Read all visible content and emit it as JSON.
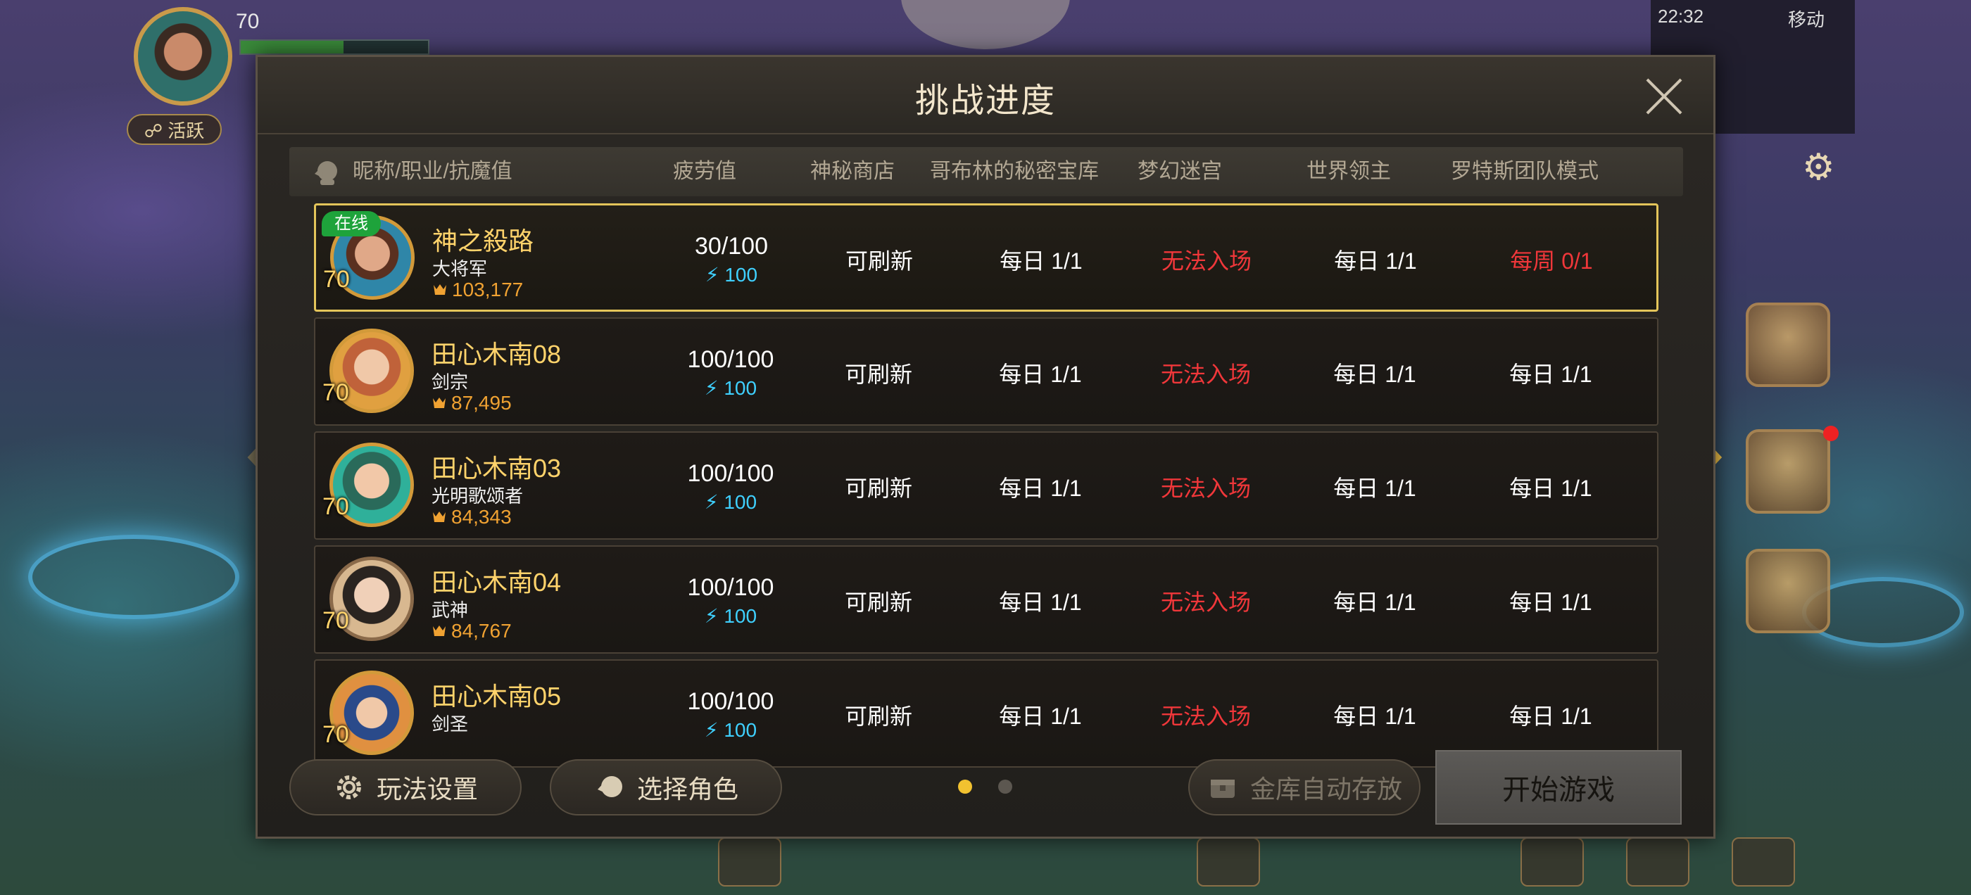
{
  "background": {
    "hud": {
      "level": "70",
      "pill_label": "☍ 活跃",
      "status_time": "22:32",
      "status_right": "移动"
    }
  },
  "dialog": {
    "title": "挑战进度",
    "columns": {
      "name": "昵称/职业/抗魔值",
      "fatigue": "疲劳值",
      "mystery_shop": "神秘商店",
      "goblin_vault": "哥布林的秘密宝库",
      "dream_maze": "梦幻迷宫",
      "world_boss": "世界领主",
      "lotus_raid": "罗特斯团队模式"
    },
    "rows": [
      {
        "online": "在线",
        "level": "70",
        "name": "神之殺路",
        "class": "大将军",
        "power": "103,177",
        "fatigue": "30/100",
        "fatigue_bonus": "100",
        "mystery_shop": "可刷新",
        "goblin_vault": "每日 1/1",
        "dream_maze": "无法入场",
        "world_boss": "每日 1/1",
        "lotus_raid": "每周 0/1"
      },
      {
        "level": "70",
        "name": "田心木南08",
        "class": "剑宗",
        "power": "87,495",
        "fatigue": "100/100",
        "fatigue_bonus": "100",
        "mystery_shop": "可刷新",
        "goblin_vault": "每日 1/1",
        "dream_maze": "无法入场",
        "world_boss": "每日 1/1",
        "lotus_raid": "每日 1/1"
      },
      {
        "level": "70",
        "name": "田心木南03",
        "class": "光明歌颂者",
        "power": "84,343",
        "fatigue": "100/100",
        "fatigue_bonus": "100",
        "mystery_shop": "可刷新",
        "goblin_vault": "每日 1/1",
        "dream_maze": "无法入场",
        "world_boss": "每日 1/1",
        "lotus_raid": "每日 1/1"
      },
      {
        "level": "70",
        "name": "田心木南04",
        "class": "武神",
        "power": "84,767",
        "fatigue": "100/100",
        "fatigue_bonus": "100",
        "mystery_shop": "可刷新",
        "goblin_vault": "每日 1/1",
        "dream_maze": "无法入场",
        "world_boss": "每日 1/1",
        "lotus_raid": "每日 1/1"
      },
      {
        "level": "70",
        "name": "田心木南05",
        "class": "剑圣",
        "power": "",
        "fatigue": "100/100",
        "fatigue_bonus": "100",
        "mystery_shop": "可刷新",
        "goblin_vault": "每日 1/1",
        "dream_maze": "无法入场",
        "world_boss": "每日 1/1",
        "lotus_raid": "每日 1/1"
      }
    ],
    "footer": {
      "settings_label": "玩法设置",
      "select_role_label": "选择角色",
      "auto_store_label": "金库自动存放",
      "start_label": "开始游戏",
      "page_count": 2,
      "current_page": 1
    },
    "colors": {
      "accent_gold": "#ffd36b",
      "warn_red": "#f0373a",
      "online_green": "#1ea33b",
      "fatigue_blue": "#3fd0ff"
    }
  }
}
